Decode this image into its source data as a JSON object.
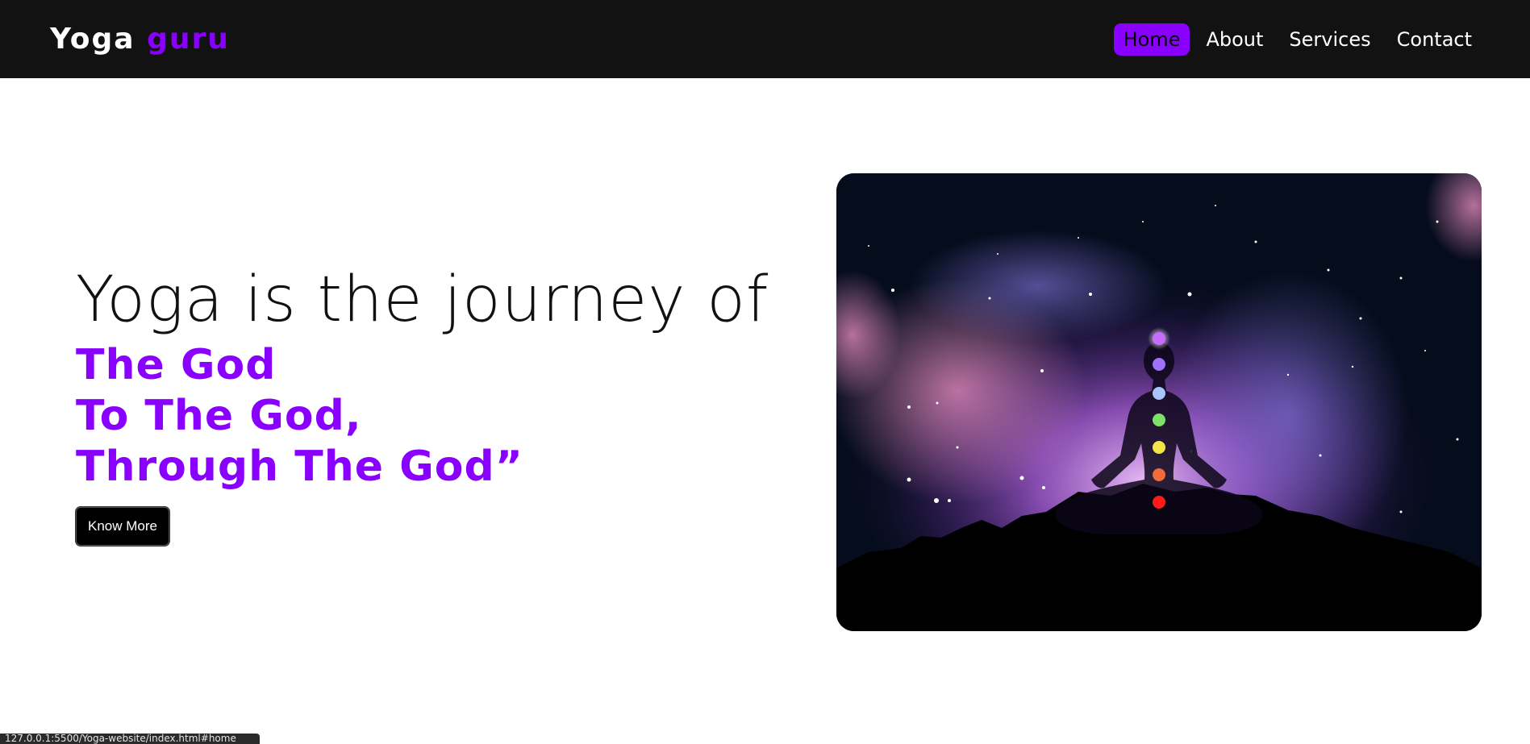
{
  "logo": {
    "primary": "Yoga",
    "accent": "guru"
  },
  "nav": {
    "items": [
      {
        "label": "Home",
        "active": true
      },
      {
        "label": "About",
        "active": false
      },
      {
        "label": "Services",
        "active": false
      },
      {
        "label": "Contact",
        "active": false
      }
    ]
  },
  "hero": {
    "headline": "Yoga is the journey of",
    "lines": [
      "The God",
      "To The God,",
      "Through The God”"
    ],
    "cta_label": "Know More"
  },
  "status_bar": {
    "url": "127.0.0.1:5500/Yoga-website/index.html#home"
  },
  "colors": {
    "accent": "#8a00ff",
    "nav_bg": "#121212",
    "text_dark": "#111111"
  },
  "image": {
    "subject": "meditating-figure-with-chakras-icon"
  }
}
